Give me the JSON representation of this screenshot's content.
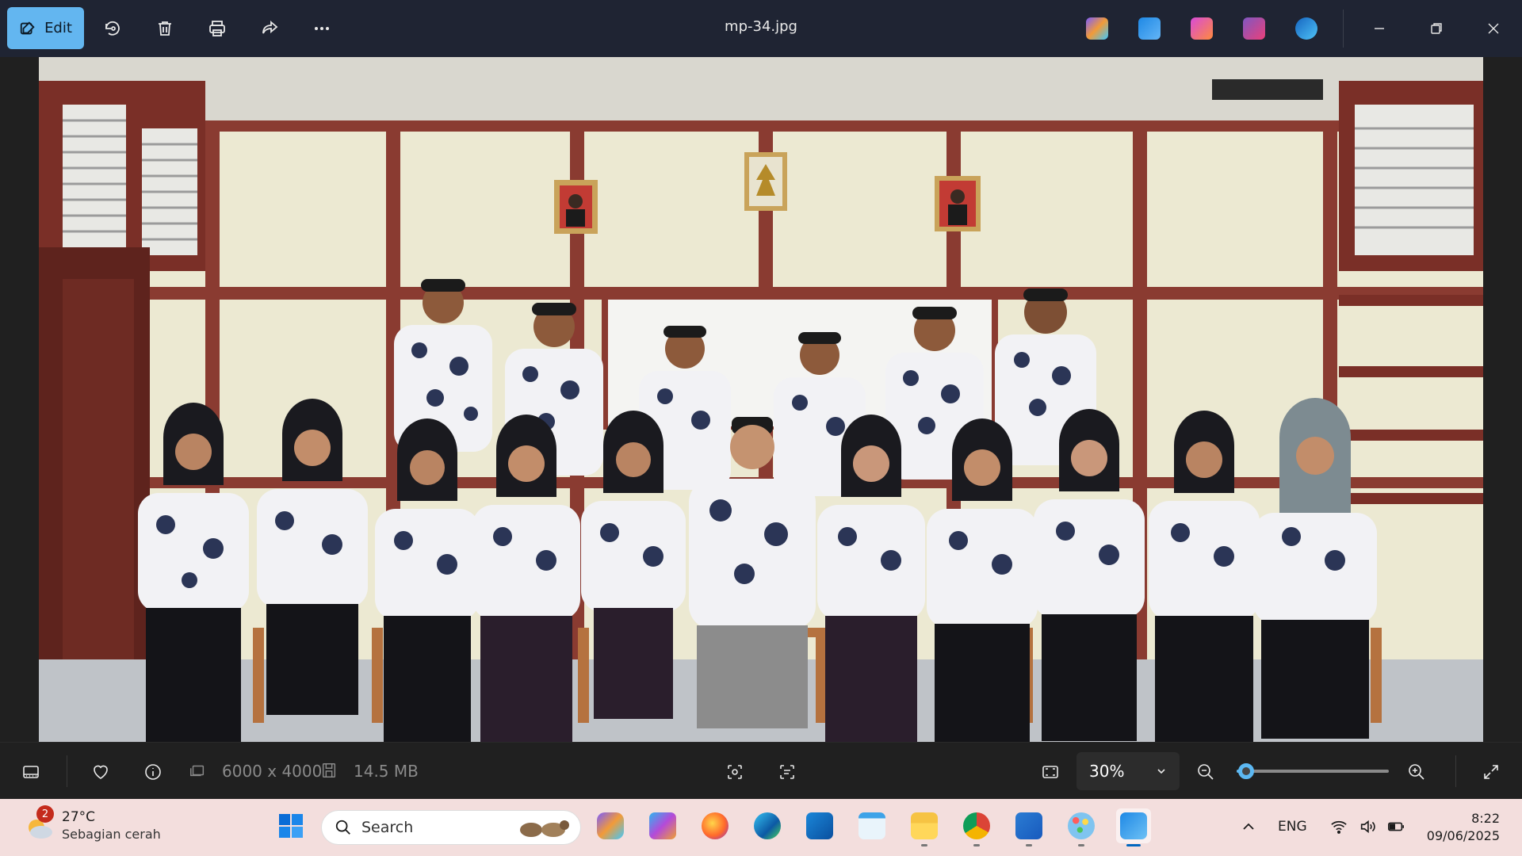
{
  "toolbar": {
    "edit_label": "Edit",
    "file_name": "mp-34.jpg",
    "actions": [
      "rotate-icon",
      "delete-icon",
      "print-icon",
      "share-icon",
      "more-icon"
    ],
    "app_shortcuts": [
      "copilot",
      "photos-editor",
      "clipchamp",
      "video-editor",
      "onedrive"
    ]
  },
  "info": {
    "dimensions": "6000 x 4000",
    "file_size": "14.5 MB",
    "zoom": "30%",
    "zoom_level": 0.06
  },
  "taskbar": {
    "weather_badge": "2",
    "temperature": "27°C",
    "weather_condition": "Sebagian cerah",
    "search_placeholder": "Search",
    "language": "ENG",
    "time": "8:22",
    "date": "09/06/2025"
  },
  "colors": {
    "accent": "#63b6f0",
    "titlebar": "#1f2433",
    "taskbar": "#f3dedd",
    "slider": "#5cb8f2"
  }
}
